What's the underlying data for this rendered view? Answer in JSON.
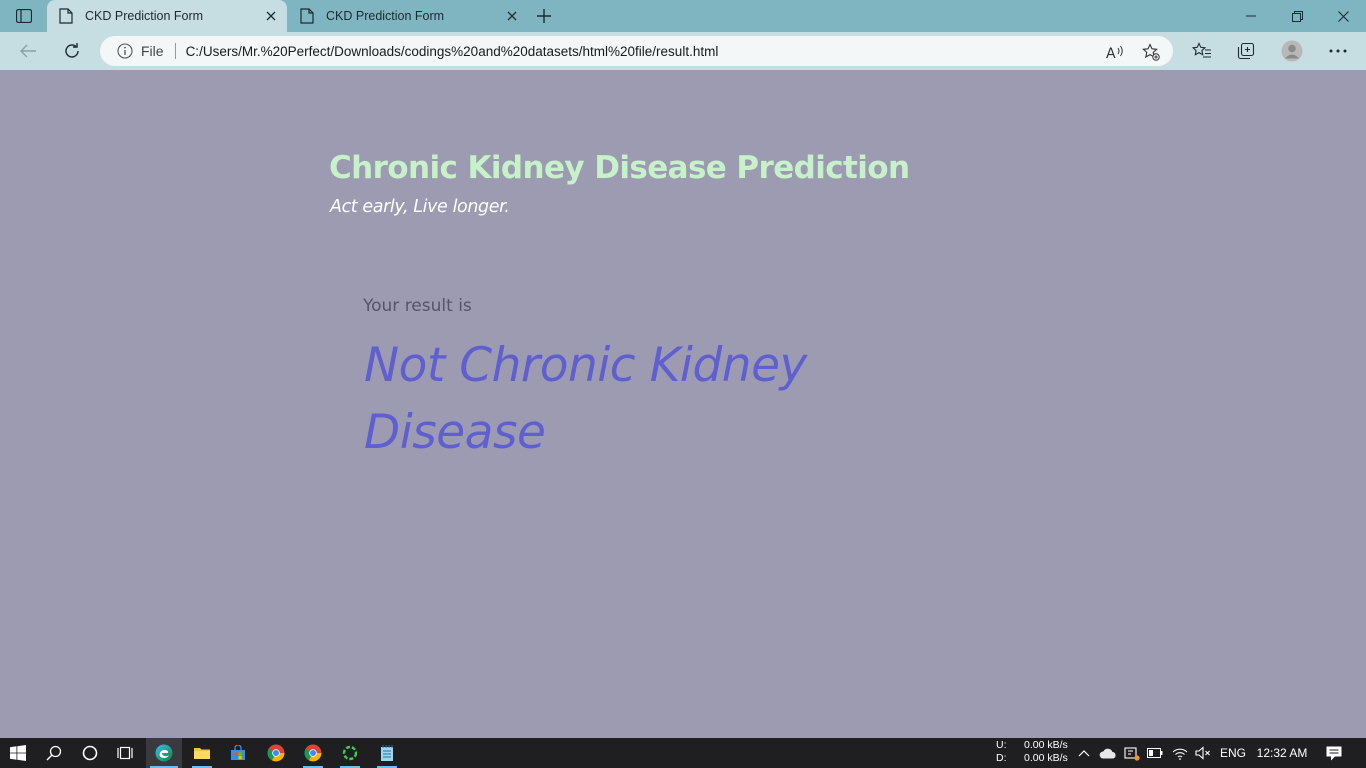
{
  "browser": {
    "tabs": [
      {
        "title": "CKD Prediction Form",
        "active": true
      },
      {
        "title": "CKD Prediction Form",
        "active": false
      }
    ],
    "address": {
      "scheme_label": "File",
      "url": "C:/Users/Mr.%20Perfect/Downloads/codings%20and%20datasets/html%20file/result.html"
    }
  },
  "page": {
    "title": "Chronic Kidney Disease Prediction",
    "tagline": "Act early, Live longer.",
    "result_label": "Your result is",
    "result_value": "Not Chronic Kidney Disease",
    "colors": {
      "background": "#9c9bb2",
      "title": "#c7f2c9",
      "result": "#5f5fcf"
    }
  },
  "taskbar": {
    "apps": [
      "windows-start",
      "search",
      "cortana",
      "task-view",
      "edge",
      "file-explorer",
      "store",
      "chrome",
      "chrome-profile",
      "loading-app",
      "notepad"
    ],
    "net_speed": {
      "upload_label": "U:",
      "upload_value": "0.00 kB/s",
      "download_label": "D:",
      "download_value": "0.00 kB/s"
    },
    "language": "ENG",
    "time": "12:32 AM"
  }
}
